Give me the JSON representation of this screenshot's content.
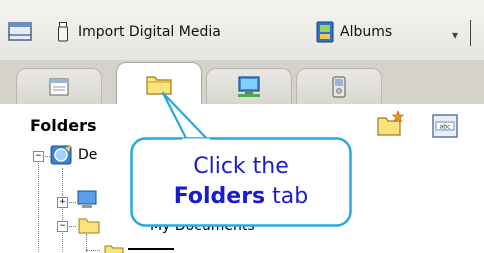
{
  "toolbar": {
    "import_label": "Import Digital Media",
    "albums_label": "Albums"
  },
  "tabs": [
    {
      "name": "calendar",
      "icon": "calendar-icon",
      "active": false
    },
    {
      "name": "folders",
      "icon": "folder-icon",
      "active": true
    },
    {
      "name": "computer",
      "icon": "computer-icon",
      "active": false
    },
    {
      "name": "device",
      "icon": "device-icon",
      "active": false
    }
  ],
  "panel": {
    "heading": "Folders",
    "tree": [
      {
        "label": "De",
        "icon": "desktop-icon",
        "expander": "−"
      },
      {
        "label": "",
        "icon": "computer-icon",
        "expander": "+"
      },
      {
        "label": "My Documents",
        "icon": "my-documents-icon",
        "expander": "−"
      }
    ]
  },
  "callout": {
    "line1": "Click the",
    "line2_bold": "Folders",
    "line2_rest": " tab"
  },
  "colors": {
    "callout_border": "#2aa8e0",
    "callout_text": "#1a1ad0",
    "callout_fill": "#ffffff"
  }
}
